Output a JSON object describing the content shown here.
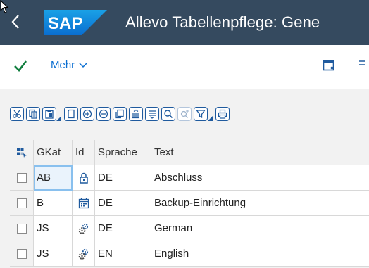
{
  "shell": {
    "logo_text": "SAP",
    "title": "Allevo Tabellenpflege: Gene"
  },
  "toolbar": {
    "mehr_label": "Mehr"
  },
  "alv_toolbar": {
    "buttons": [
      "cut-icon",
      "copy-icon",
      "paste-icon",
      "new-page-icon",
      "add-row-icon",
      "remove-row-icon",
      "duplicate-icon",
      "align-center-icon",
      "align-justify-icon",
      "search-icon",
      "search-next-icon",
      "filter-icon",
      "print-icon"
    ]
  },
  "table": {
    "columns": [
      "GKat",
      "Id",
      "Sprache",
      "Text"
    ],
    "rows": [
      {
        "gkat": "AB",
        "id_icon": "lock-icon",
        "sprache": "DE",
        "text": "Abschluss"
      },
      {
        "gkat": "B",
        "id_icon": "calendar-icon",
        "sprache": "DE",
        "text": "Backup-Einrichtung"
      },
      {
        "gkat": "JS",
        "id_icon": "gears-icon",
        "sprache": "DE",
        "text": "German"
      },
      {
        "gkat": "JS",
        "id_icon": "gears-icon",
        "sprache": "EN",
        "text": "English"
      }
    ]
  },
  "colors": {
    "shell_bg": "#354a5f",
    "accent": "#0a6ed1",
    "check_green": "#107e3e",
    "icon_blue": "#1f5a9e"
  }
}
